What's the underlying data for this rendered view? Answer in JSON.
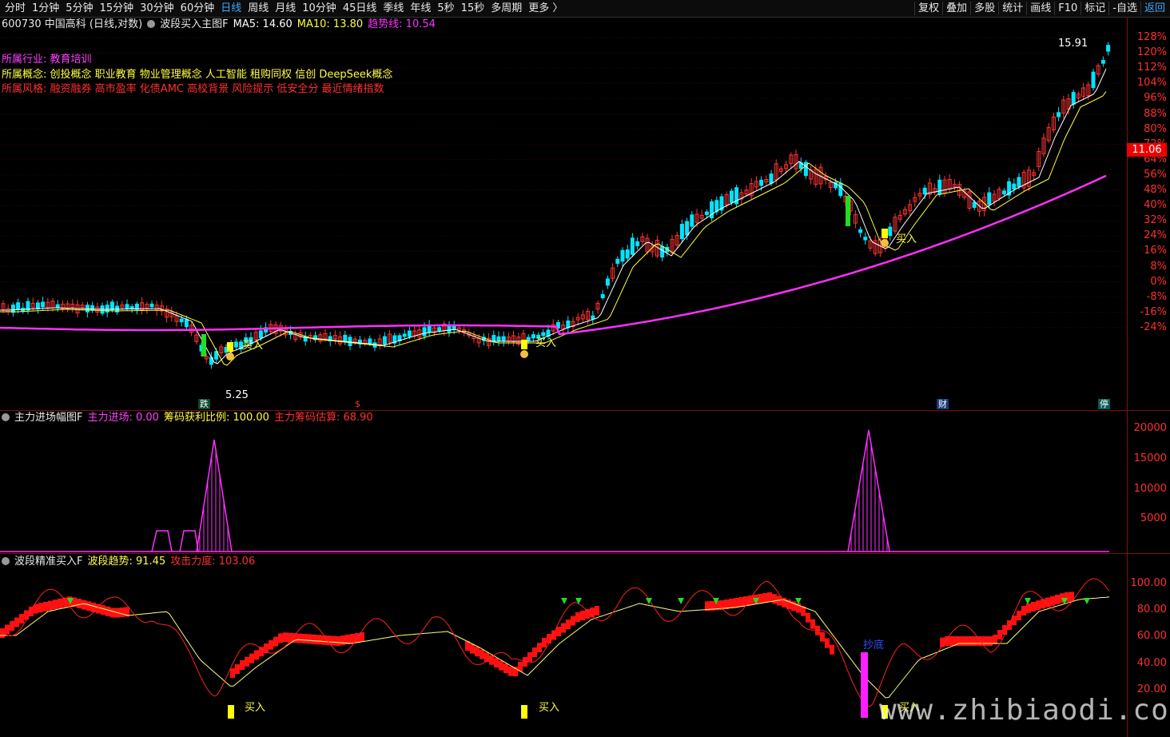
{
  "toolbar": {
    "periods": [
      "分时",
      "1分钟",
      "5分钟",
      "15分钟",
      "30分钟",
      "60分钟",
      "日线",
      "周线",
      "月线",
      "10分钟",
      "45日线",
      "季线",
      "年线",
      "5秒",
      "15秒",
      "多周期",
      "更多 〉"
    ],
    "active_period": "日线",
    "right_tools": [
      "复权",
      "叠加",
      "多股",
      "统计",
      "画线",
      "F10",
      "标记",
      "-自选",
      "返回"
    ]
  },
  "main_panel": {
    "stock": "600730 中国高科 (日线,对数)",
    "indicator": "波段买入主图F",
    "ma5": "MA5: 14.60",
    "ma10": "MA10: 13.80",
    "trend": "趋势线: 10.54",
    "industry_label": "所属行业:",
    "industry": "教育培训",
    "concept_label": "所属概念:",
    "concepts": "创投概念 职业教育 物业管理概念 人工智能 租购同权 信创 DeepSeek概念",
    "style_label": "所属风格:",
    "styles": "融资融券 高市盈率 化债AMC 高校背景 风险提示 低安全分 最近情绪指数",
    "high_label": "15.91",
    "low_label": "5.25",
    "price_box": "11.06",
    "buy_label": "买入",
    "axis": [
      "128%",
      "120%",
      "112%",
      "104%",
      "96%",
      "88%",
      "80%",
      "72%",
      "64%",
      "56%",
      "48%",
      "40%",
      "32%",
      "24%",
      "16%",
      "8%",
      "0%",
      "-8%",
      "-16%",
      "-24%"
    ],
    "badge_die": "跌",
    "badge_cai": "财",
    "badge_ting": "停",
    "badge_s": "$",
    "colors": {
      "up": "#ff3333",
      "down": "#00e5ff",
      "ma5": "#ffffff",
      "ma10": "#ffff40",
      "trend": "#ff30ff",
      "accent": "#ee0000"
    }
  },
  "panel2": {
    "title": "主力进场幅图F",
    "main_in": "主力进场: 0.00",
    "chip_ratio": "筹码获利比例: 100.00",
    "chip_est": "主力筹码估算: 68.90",
    "axis": [
      "20000",
      "15000",
      "10000",
      "5000"
    ]
  },
  "panel3": {
    "title": "波段精准买入F",
    "trend": "波段趋势: 91.45",
    "attack": "攻击力度: 103.06",
    "axis": [
      "100.00",
      "80.00",
      "60.00",
      "40.00",
      "20.00"
    ],
    "bottom_label": "抄底",
    "buy_label": "买入"
  },
  "watermark": "www.zhibiaodi.com"
}
